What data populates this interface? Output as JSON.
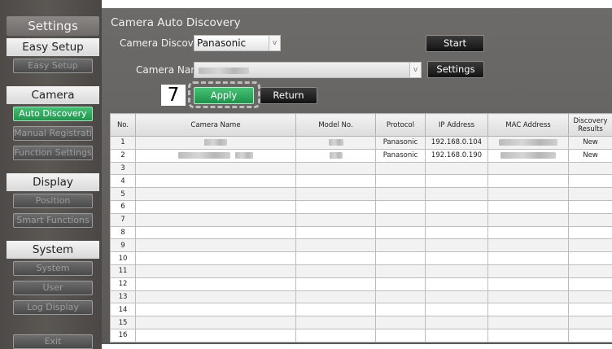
{
  "sidebar": {
    "title": "Settings",
    "sections": [
      {
        "heading": "Easy Setup",
        "items": [
          "Easy Setup"
        ]
      },
      {
        "heading": "Camera",
        "items": [
          "Auto Discovery",
          "Manual Registration",
          "Function Settings"
        ]
      },
      {
        "heading": "Display",
        "items": [
          "Position",
          "Smart Functions"
        ]
      },
      {
        "heading": "System",
        "items": [
          "System",
          "User",
          "Log Display"
        ]
      }
    ],
    "exit_label": "Exit"
  },
  "main": {
    "title": "Camera Auto Discovery",
    "camera_discovery_label": "Camera Discovery",
    "camera_discovery_value": "Panasonic",
    "camera_name_label": "Camera Name",
    "dropdown_arrow": "v",
    "start_label": "Start",
    "settings_label": "Settings",
    "apply_label": "Apply",
    "return_label": "Return",
    "step_number": "7"
  },
  "table": {
    "headers": [
      "No.",
      "Camera Name",
      "Model No.",
      "Protocol",
      "IP Address",
      "MAC Address",
      "Discovery Results"
    ],
    "rows": [
      {
        "no": "1",
        "protocol": "Panasonic",
        "ip": "192.168.0.104",
        "result": "New"
      },
      {
        "no": "2",
        "protocol": "Panasonic",
        "ip": "192.168.0.190",
        "result": "New"
      },
      {
        "no": "3"
      },
      {
        "no": "4"
      },
      {
        "no": "5"
      },
      {
        "no": "6"
      },
      {
        "no": "7"
      },
      {
        "no": "8"
      },
      {
        "no": "9"
      },
      {
        "no": "10"
      },
      {
        "no": "11"
      },
      {
        "no": "12"
      },
      {
        "no": "13"
      },
      {
        "no": "14"
      },
      {
        "no": "15"
      },
      {
        "no": "16"
      }
    ]
  },
  "colors": {
    "accent_green": "#2fa85d",
    "panel_gray": "#636160",
    "sidebar_dark": "#4f4c49"
  }
}
